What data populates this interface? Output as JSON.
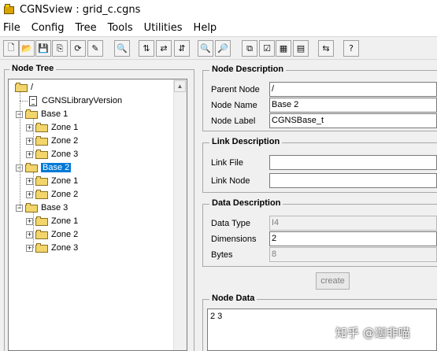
{
  "window": {
    "title": "CGNSview : grid_c.cgns"
  },
  "menu": [
    "File",
    "Config",
    "Tree",
    "Tools",
    "Utilities",
    "Help"
  ],
  "toolbar": [
    {
      "name": "new-file-icon",
      "glyph": "🗋"
    },
    {
      "name": "open-folder-icon",
      "glyph": "📂"
    },
    {
      "name": "save-icon",
      "glyph": "💾"
    },
    {
      "name": "copy-file-icon",
      "glyph": "⎘"
    },
    {
      "name": "refresh-file-icon",
      "glyph": "⟳"
    },
    {
      "name": "properties-icon",
      "glyph": "✎"
    },
    {
      "name": "preview-icon",
      "glyph": "🔍"
    },
    {
      "name": "sort-icon",
      "glyph": "⇅"
    },
    {
      "name": "sort-alt-icon",
      "glyph": "⇄"
    },
    {
      "name": "arrange-icon",
      "glyph": "⇵"
    },
    {
      "name": "find-icon",
      "glyph": "🔍"
    },
    {
      "name": "find-next-icon",
      "glyph": "🔎"
    },
    {
      "name": "copy-node-icon",
      "glyph": "⧉"
    },
    {
      "name": "check-icon",
      "glyph": "☑"
    },
    {
      "name": "grid-view-icon",
      "glyph": "▦"
    },
    {
      "name": "table-view-icon",
      "glyph": "▤"
    },
    {
      "name": "convert-icon",
      "glyph": "⇆"
    },
    {
      "name": "help-icon",
      "glyph": "?"
    }
  ],
  "node_tree": {
    "title": "Node Tree",
    "nodes": [
      {
        "label": "/",
        "type": "folder",
        "level": 0,
        "expander": ""
      },
      {
        "label": "CGNSLibraryVersion",
        "type": "doc",
        "level": 1,
        "expander": ""
      },
      {
        "label": "Base 1",
        "type": "folder",
        "level": 1,
        "expander": "−"
      },
      {
        "label": "Zone 1",
        "type": "folder",
        "level": 2,
        "expander": "+"
      },
      {
        "label": "Zone 2",
        "type": "folder",
        "level": 2,
        "expander": "+"
      },
      {
        "label": "Zone 3",
        "type": "folder",
        "level": 2,
        "expander": "+"
      },
      {
        "label": "Base 2",
        "type": "folder",
        "level": 1,
        "expander": "−",
        "selected": true
      },
      {
        "label": "Zone 1",
        "type": "folder",
        "level": 2,
        "expander": "+"
      },
      {
        "label": "Zone 2",
        "type": "folder",
        "level": 2,
        "expander": "+"
      },
      {
        "label": "Base 3",
        "type": "folder",
        "level": 1,
        "expander": "−"
      },
      {
        "label": "Zone 1",
        "type": "folder",
        "level": 2,
        "expander": "+"
      },
      {
        "label": "Zone 2",
        "type": "folder",
        "level": 2,
        "expander": "+"
      },
      {
        "label": "Zone 3",
        "type": "folder",
        "level": 2,
        "expander": "+"
      }
    ]
  },
  "node_description": {
    "title": "Node Description",
    "parent_node_label": "Parent Node",
    "parent_node": "/",
    "node_name_label": "Node Name",
    "node_name": "Base 2",
    "node_label_label": "Node Label",
    "node_label": "CGNSBase_t"
  },
  "link_description": {
    "title": "Link Description",
    "link_file_label": "Link File",
    "link_file": "",
    "link_node_label": "Link Node",
    "link_node": ""
  },
  "data_description": {
    "title": "Data Description",
    "data_type_label": "Data Type",
    "data_type": "I4",
    "dimensions_label": "Dimensions",
    "dimensions": "2",
    "bytes_label": "Bytes",
    "bytes": "8",
    "create_label": "create"
  },
  "node_data": {
    "title": "Node Data",
    "value": "2 3"
  },
  "watermark": "知乎 @迦非喵"
}
